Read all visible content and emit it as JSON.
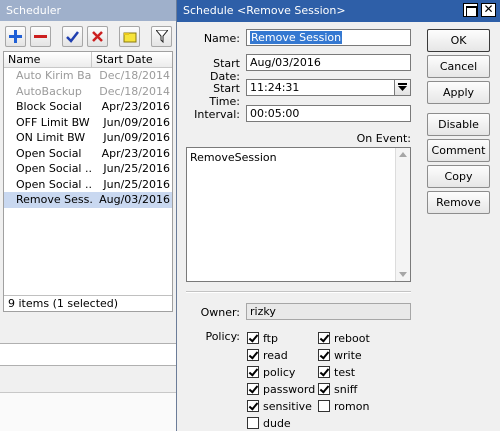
{
  "scheduler": {
    "title": "Scheduler",
    "columns": {
      "name": "Name",
      "start_date": "Start Date"
    },
    "rows": [
      {
        "name": "Auto Kirim Ba...",
        "start_date": "Dec/18/2014",
        "state": "disabled"
      },
      {
        "name": "AutoBackup",
        "start_date": "Dec/18/2014",
        "state": "disabled"
      },
      {
        "name": "Block Social",
        "start_date": "Apr/23/2016",
        "state": "normal"
      },
      {
        "name": "OFF Limit BW",
        "start_date": "Jun/09/2016",
        "state": "normal"
      },
      {
        "name": "ON Limit BW",
        "start_date": "Jun/09/2016",
        "state": "normal"
      },
      {
        "name": "Open Social",
        "start_date": "Apr/23/2016",
        "state": "normal"
      },
      {
        "name": "Open Social ...",
        "start_date": "Jun/25/2016",
        "state": "normal"
      },
      {
        "name": "Open Social ...",
        "start_date": "Jun/25/2016",
        "state": "normal"
      },
      {
        "name": "Remove Sess...",
        "start_date": "Aug/03/2016",
        "state": "selected"
      }
    ],
    "status": "9 items (1 selected)",
    "toolbar_icons": [
      "add-icon",
      "remove-icon",
      "enable-check-icon",
      "disable-x-icon",
      "comment-note-icon",
      "filter-icon"
    ]
  },
  "dialog": {
    "title": "Schedule <Remove Session>",
    "fields": {
      "name_label": "Name:",
      "name_value": "Remove Session",
      "start_date_label": "Start Date:",
      "start_date_value": "Aug/03/2016",
      "start_time_label": "Start Time:",
      "start_time_value": "11:24:31",
      "interval_label": "Interval:",
      "interval_value": "00:05:00",
      "on_event_label": "On Event:",
      "on_event_value": "RemoveSession",
      "owner_label": "Owner:",
      "owner_value": "rizky",
      "policy_label": "Policy:"
    },
    "policies": [
      {
        "label": "ftp",
        "checked": true
      },
      {
        "label": "reboot",
        "checked": true
      },
      {
        "label": "read",
        "checked": true
      },
      {
        "label": "write",
        "checked": true
      },
      {
        "label": "policy",
        "checked": true
      },
      {
        "label": "test",
        "checked": true
      },
      {
        "label": "password",
        "checked": true
      },
      {
        "label": "sniff",
        "checked": true
      },
      {
        "label": "sensitive",
        "checked": true
      },
      {
        "label": "romon",
        "checked": false
      },
      {
        "label": "dude",
        "checked": false
      }
    ],
    "buttons": {
      "ok": "OK",
      "cancel": "Cancel",
      "apply": "Apply",
      "disable": "Disable",
      "comment": "Comment",
      "copy": "Copy",
      "remove": "Remove"
    }
  },
  "colors": {
    "dialog_titlebar": "#2e5fa8",
    "inactive_titlebar": "#9fb0cb",
    "selection": "#3478d1",
    "selected_row": "#c9d8f0",
    "add_icon": "#1f5fd6",
    "remove_icon": "#cc1f1f"
  }
}
